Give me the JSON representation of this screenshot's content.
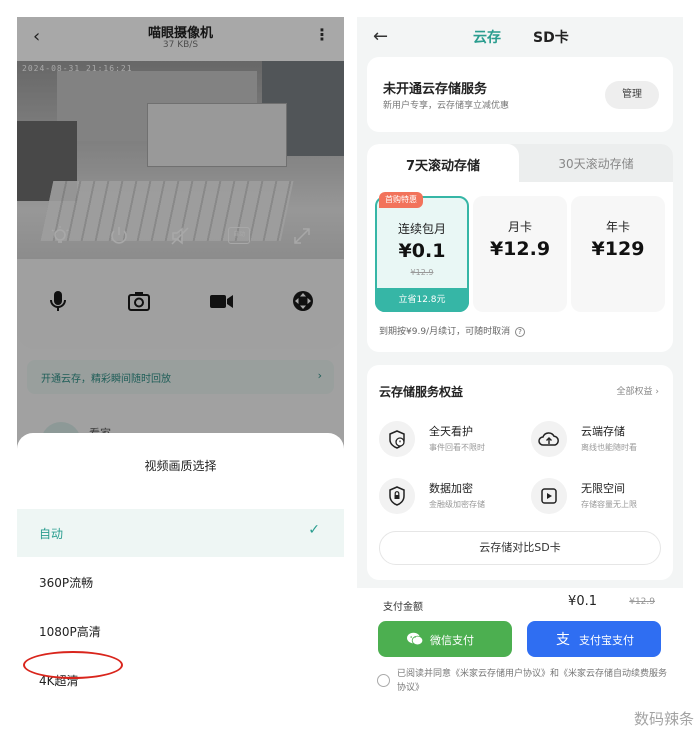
{
  "left_screen": {
    "header": {
      "back_icon": "chevron-left-icon",
      "title": "喵眼摄像机",
      "speed": "37 KB/S",
      "more_icon": "more-vertical-icon"
    },
    "video": {
      "timestamp": "2024-08-31 21:16:21",
      "controls": [
        "light-icon",
        "power-icon",
        "mute-icon",
        "auto-icon",
        "fullscreen-icon"
      ],
      "auto_label": "自动"
    },
    "toolbar": [
      "microphone-icon",
      "camera-icon",
      "video-record-icon",
      "ptz-icon"
    ],
    "banner": {
      "text": "开通云存，精彩瞬间随时回放",
      "arrow": "›"
    },
    "peek_text": "看家",
    "sheet": {
      "title": "视频画质选择",
      "options": [
        {
          "label": "自动",
          "selected": true
        },
        {
          "label": "360P流畅",
          "selected": false
        },
        {
          "label": "1080P高清",
          "selected": false
        },
        {
          "label": "4K超清",
          "selected": false
        }
      ],
      "check": "✓"
    }
  },
  "right_screen": {
    "header": {
      "back_icon": "arrow-left-icon",
      "tab_cloud": "云存",
      "tab_sd": "SD卡"
    },
    "service": {
      "title": "未开通云存储服务",
      "subtitle": "新用户专享，云存储享立减优惠",
      "manage": "管理"
    },
    "plans": {
      "tab_active": "7天滚动存储",
      "tab_inactive": "30天滚动存储",
      "items": [
        {
          "badge": "首购特惠",
          "name": "连续包月",
          "price": "¥0.1",
          "old": "¥12.9",
          "save": "立省12.8元",
          "selected": true
        },
        {
          "name": "月卡",
          "price": "¥12.9",
          "selected": false
        },
        {
          "name": "年卡",
          "price": "¥129",
          "selected": false
        }
      ],
      "renew": "到期按¥9.9/月续订，可随时取消"
    },
    "benefits": {
      "title": "云存储服务权益",
      "all": "全部权益 ›",
      "items": [
        {
          "title": "全天看护",
          "sub": "事件回看不限时",
          "icon": "clock-shield-icon"
        },
        {
          "title": "云端存储",
          "sub": "离线也能随时看",
          "icon": "cloud-upload-icon"
        },
        {
          "title": "数据加密",
          "sub": "金融级加密存储",
          "icon": "shield-lock-icon"
        },
        {
          "title": "无限空间",
          "sub": "存储容量无上限",
          "icon": "video-file-icon"
        }
      ],
      "compare": "云存储对比SD卡"
    },
    "payment": {
      "label": "支付金额",
      "price": "¥0.1",
      "old": "¥12.9",
      "wechat": "微信支付",
      "alipay": "支付宝支付",
      "agree": "已阅读并同意《米家云存储用户协议》和《米家云存储自动续费服务协议》"
    },
    "colors": {
      "accent": "#2a9d8f",
      "wechat": "#4caf50",
      "alipay": "#2f6ef2",
      "badge": "#f2735b"
    }
  },
  "watermark": "数码辣条"
}
